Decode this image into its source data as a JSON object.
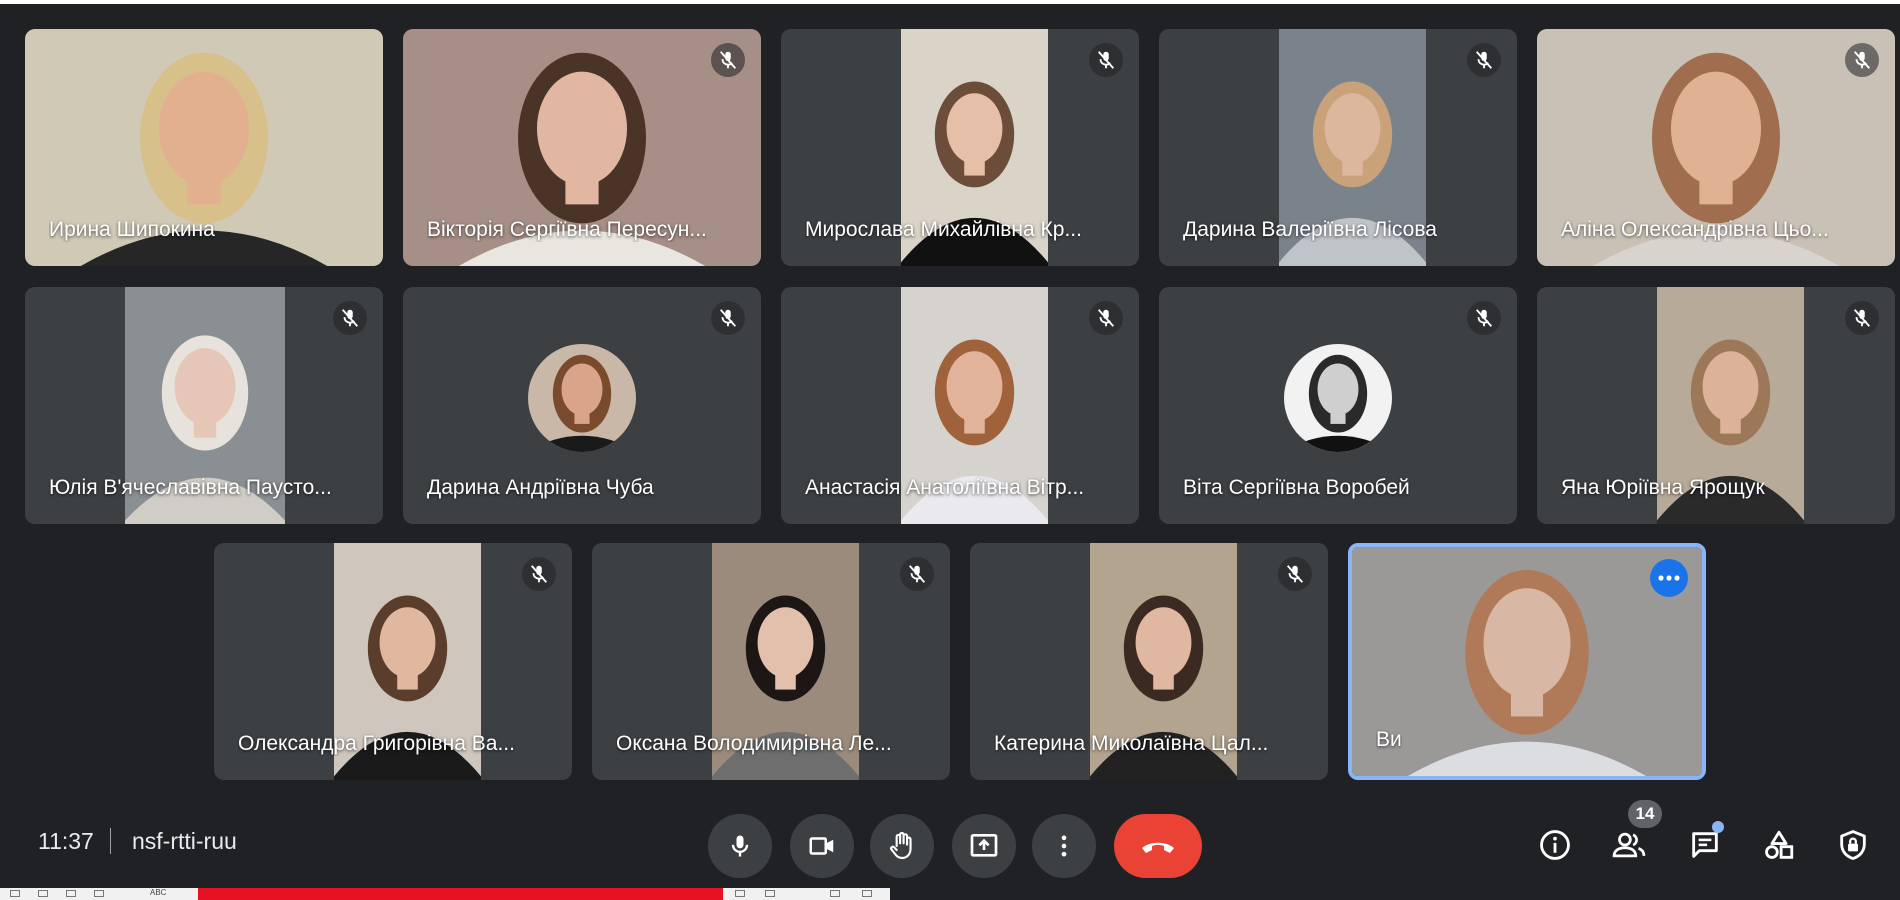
{
  "participants": [
    {
      "name": "Ирина Шипокина",
      "muted": false,
      "bg": "#cfc9b6",
      "face": "#e3b08f",
      "hair": "#d8c08a",
      "shirt": "#262626"
    },
    {
      "name": "Вікторія Сергіївна Пересун...",
      "muted": true,
      "bg": "#a58f86",
      "face": "#e2b7a1",
      "hair": "#4a3327",
      "shirt": "#e9e5df"
    },
    {
      "name": "Мирослава Михайлівна Кр...",
      "muted": true,
      "bg": "#d9d3c8",
      "face": "#e6bfa8",
      "hair": "#6b4d3a",
      "shirt": "#111111"
    },
    {
      "name": "Дарина Валеріївна Лісова",
      "muted": true,
      "bg": "#7a838c",
      "face": "#dcb79d",
      "hair": "#c9a27a",
      "shirt": "#bfc4c8"
    },
    {
      "name": "Аліна Олександрівна Цьо...",
      "muted": true,
      "bg": "#c9c1b5",
      "face": "#e0b293",
      "hair": "#a06d4e",
      "shirt": "#d8d3cc"
    },
    {
      "name": "Юлія В'ячеславівна Паусто...",
      "muted": true,
      "bg": "#8a8f93",
      "face": "#e6c7b7",
      "hair": "#e7e3dc",
      "shirt": "#d0ccc6"
    },
    {
      "name": "Дарина Андріївна Чуба",
      "muted": true,
      "bg": "#3c4043",
      "face": "#d9a48a",
      "hair": "#7a4a2c",
      "shirt": "#1a1a1a",
      "avatar": true
    },
    {
      "name": "Анастасія Анатоліївна Вітр...",
      "muted": true,
      "bg": "#d6d2cd",
      "face": "#e0b39a",
      "hair": "#a0623a",
      "shirt": "#e9e9ee"
    },
    {
      "name": "Віта Сергіївна Воробей",
      "muted": true,
      "bg": "#3c4043",
      "face": "#cfcfcf",
      "hair": "#2a2a2a",
      "shirt": "#111111",
      "avatar": true
    },
    {
      "name": "Яна Юріївна Ярощук",
      "muted": true,
      "bg": "#b7aa98",
      "face": "#dcb298",
      "hair": "#9c7859",
      "shirt": "#2a2a2a"
    },
    {
      "name": "Олександра Григорівна Ва...",
      "muted": true,
      "bg": "#cfc7bd",
      "face": "#e0b89f",
      "hair": "#5a3d2b",
      "shirt": "#1a1a1a"
    },
    {
      "name": "Оксана Володимирівна Ле...",
      "muted": true,
      "bg": "#9a8b7c",
      "face": "#e2c0ab",
      "hair": "#1c1714",
      "shirt": "#6e6e6e"
    },
    {
      "name": "Катерина Миколаївна Цал...",
      "muted": true,
      "bg": "#b2a48f",
      "face": "#e0b7a0",
      "hair": "#3b2a22",
      "shirt": "#222222"
    },
    {
      "name": "Ви",
      "muted": false,
      "bg": "#9b9998",
      "face": "#d8b8a4",
      "hair": "#b07a58",
      "shirt": "#dcdde0",
      "self": true
    }
  ],
  "bottom_bar": {
    "time": "11:37",
    "meeting_code": "nsf-rtti-ruu",
    "participants_count": "14"
  },
  "taskbar": {
    "label": "ABC"
  },
  "colors": {
    "background": "#202124",
    "tile": "#3c4043",
    "end_call": "#ea4335",
    "self_border": "#8ab4f8",
    "accent": "#1a73e8"
  }
}
